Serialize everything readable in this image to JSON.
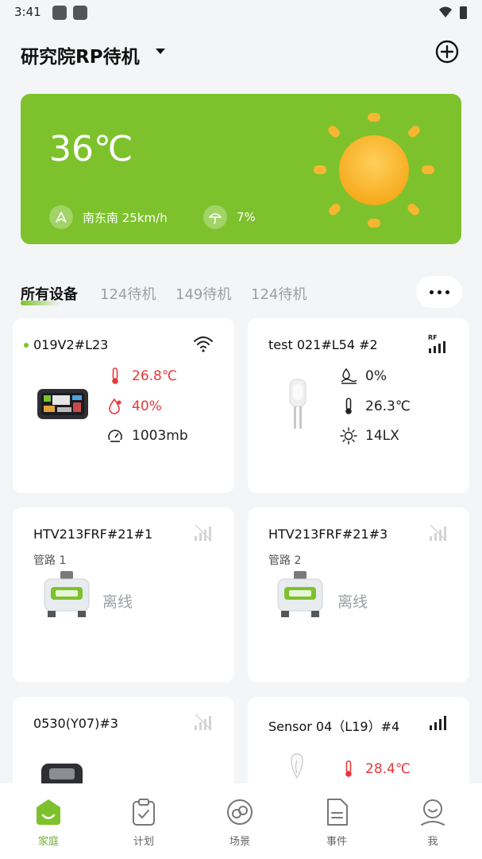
{
  "status_bar": {
    "time": "3:41"
  },
  "header": {
    "title": "研究院RP待机"
  },
  "weather": {
    "temperature": "36℃",
    "wind": "南东南 25km/h",
    "rain_chance": "7%"
  },
  "tabs": [
    "所有设备",
    "124待机",
    "149待机",
    "124待机"
  ],
  "devices": {
    "d1": {
      "name": "019V2#L23",
      "temperature": "26.8℃",
      "humidity": "40%",
      "pressure": "1003mb"
    },
    "d2": {
      "name": "test 021#L54 #2",
      "signal_label": "RF",
      "moisture": "0%",
      "temperature": "26.3℃",
      "light": "14LX"
    },
    "d3": {
      "name": "HTV213FRF#21#1",
      "pipe": "管路 1",
      "status": "离线"
    },
    "d4": {
      "name": "HTV213FRF#21#3",
      "pipe": "管路 2",
      "status": "离线"
    },
    "d5": {
      "name": "0530(Y07)#3"
    },
    "d6": {
      "name": "Sensor 04（L19）#4",
      "temperature": "28.4℃"
    }
  },
  "nav": {
    "home": "家庭",
    "plan": "计划",
    "scene": "场景",
    "event": "事件",
    "me": "我"
  },
  "colors": {
    "accent": "#7dc22c",
    "alert_red": "#e4393c",
    "sun": "#f6a91b"
  }
}
